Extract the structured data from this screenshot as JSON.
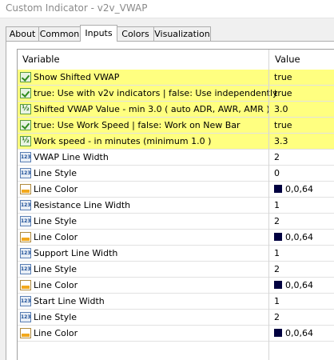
{
  "window": {
    "title": "Custom Indicator - v2v_VWAP"
  },
  "tabs": [
    {
      "label": "About"
    },
    {
      "label": "Common"
    },
    {
      "label": "Inputs",
      "active": true
    },
    {
      "label": "Colors"
    },
    {
      "label": "Visualization"
    }
  ],
  "table": {
    "headers": {
      "variable": "Variable",
      "value": "Value"
    },
    "highlight_color": "#ffff80",
    "rows": [
      {
        "icon": "bool-icon",
        "label": "Show Shifted VWAP",
        "value": "true",
        "highlighted": true
      },
      {
        "icon": "bool-icon",
        "label": "true:  Use with v2v indicators  |  false:  Use independently",
        "value": "true",
        "highlighted": true
      },
      {
        "icon": "double-icon",
        "label": "Shifted VWAP Value  - min 3.0 ( auto ADR, AWR, AMR )",
        "value": "3.0",
        "highlighted": true
      },
      {
        "icon": "bool-icon",
        "label": "true:  Use Work Speed  |  false:  Work on New Bar",
        "value": "true",
        "highlighted": true
      },
      {
        "icon": "double-icon",
        "label": "Work speed  - in minutes (minimum 1.0 )",
        "value": "3.3",
        "highlighted": true
      },
      {
        "icon": "int-icon",
        "label": "VWAP Line Width",
        "value": "2"
      },
      {
        "icon": "int-icon",
        "label": "Line Style",
        "value": "0"
      },
      {
        "icon": "color-icon",
        "label": "Line Color",
        "value": "0,0,64",
        "swatch": "#000040"
      },
      {
        "icon": "int-icon",
        "label": "Resistance Line Width",
        "value": "1"
      },
      {
        "icon": "int-icon",
        "label": "Line Style",
        "value": "2"
      },
      {
        "icon": "color-icon",
        "label": "Line Color",
        "value": "0,0,64",
        "swatch": "#000040"
      },
      {
        "icon": "int-icon",
        "label": "Support Line Width",
        "value": "1"
      },
      {
        "icon": "int-icon",
        "label": "Line Style",
        "value": "2"
      },
      {
        "icon": "color-icon",
        "label": "Line Color",
        "value": "0,0,64",
        "swatch": "#000040"
      },
      {
        "icon": "int-icon",
        "label": "Start Line Width",
        "value": "1"
      },
      {
        "icon": "int-icon",
        "label": "Line Style",
        "value": "2"
      },
      {
        "icon": "color-icon",
        "label": "Line Color",
        "value": "0,0,64",
        "swatch": "#000040"
      }
    ]
  }
}
